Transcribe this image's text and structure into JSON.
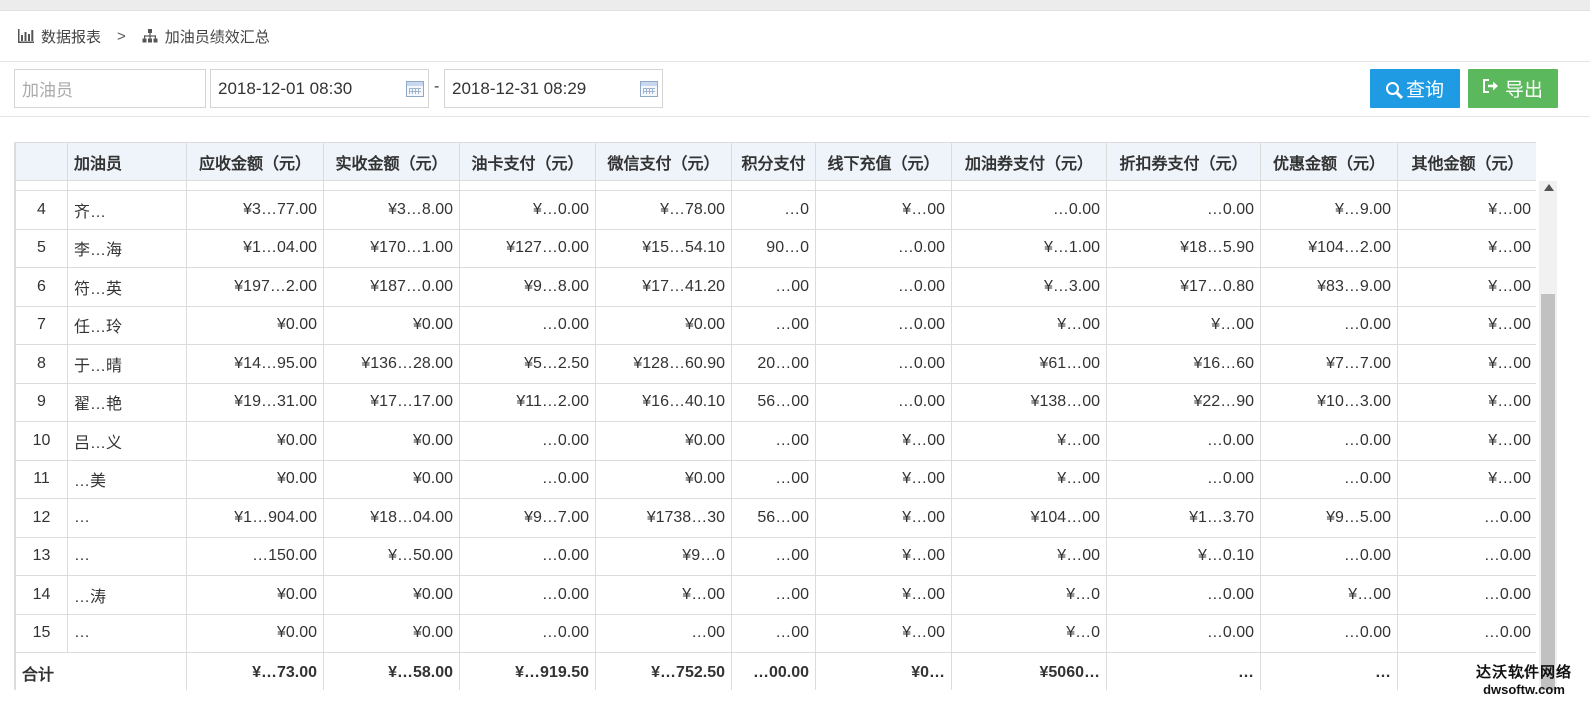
{
  "breadcrumb": {
    "parent": "数据报表",
    "separator": ">",
    "current": "加油员绩效汇总"
  },
  "filters": {
    "attendant_placeholder": "加油员",
    "start_time": "2018-12-01 08:30",
    "range_separator": "-",
    "end_time": "2018-12-31 08:29"
  },
  "buttons": {
    "query": "查询",
    "export": "导出"
  },
  "table": {
    "columns": [
      "",
      "加油员",
      "应收金额（元）",
      "实收金额（元）",
      "油卡支付（元）",
      "微信支付（元）",
      "积分支付",
      "线下充值（元）",
      "加油券支付（元）",
      "折扣券支付（元）",
      "优惠金额（元）",
      "其他金额（元）"
    ],
    "rows": [
      [
        "4",
        "齐…",
        "¥3…77.00",
        "¥3…8.00",
        "¥…0.00",
        "¥…78.00",
        "…0",
        "¥…00",
        "…0.00",
        "…0.00",
        "¥…9.00",
        "¥…00"
      ],
      [
        "5",
        "李…海",
        "¥1…04.00",
        "¥170…1.00",
        "¥127…0.00",
        "¥15…54.10",
        "90…0",
        "…0.00",
        "¥…1.00",
        "¥18…5.90",
        "¥104…2.00",
        "¥…00"
      ],
      [
        "6",
        "符…英",
        "¥197…2.00",
        "¥187…0.00",
        "¥9…8.00",
        "¥17…41.20",
        "…00",
        "…0.00",
        "¥…3.00",
        "¥17…0.80",
        "¥83…9.00",
        "¥…00"
      ],
      [
        "7",
        "任…玲",
        "¥0.00",
        "¥0.00",
        "…0.00",
        "¥0.00",
        "…00",
        "…0.00",
        "¥…00",
        "¥…00",
        "…0.00",
        "¥…00"
      ],
      [
        "8",
        "于…晴",
        "¥14…95.00",
        "¥136…28.00",
        "¥5…2.50",
        "¥128…60.90",
        "20…00",
        "…0.00",
        "¥61…00",
        "¥16…60",
        "¥7…7.00",
        "¥…00"
      ],
      [
        "9",
        "翟…艳",
        "¥19…31.00",
        "¥17…17.00",
        "¥11…2.00",
        "¥16…40.10",
        "56…00",
        "…0.00",
        "¥138…00",
        "¥22…90",
        "¥10…3.00",
        "¥…00"
      ],
      [
        "10",
        "吕…义",
        "¥0.00",
        "¥0.00",
        "…0.00",
        "¥0.00",
        "…00",
        "¥…00",
        "¥…00",
        "…0.00",
        "…0.00",
        "¥…00"
      ],
      [
        "11",
        "…美",
        "¥0.00",
        "¥0.00",
        "…0.00",
        "¥0.00",
        "…00",
        "¥…00",
        "¥…00",
        "…0.00",
        "…0.00",
        "¥…00"
      ],
      [
        "12",
        "…",
        "¥1…904.00",
        "¥18…04.00",
        "¥9…7.00",
        "¥1738…30",
        "56…00",
        "¥…00",
        "¥104…00",
        "¥1…3.70",
        "¥9…5.00",
        "…0.00"
      ],
      [
        "13",
        "…",
        "…150.00",
        "¥…50.00",
        "…0.00",
        "¥9…0",
        "…00",
        "¥…00",
        "¥…00",
        "¥…0.10",
        "…0.00",
        "…0.00"
      ],
      [
        "14",
        "…涛",
        "¥0.00",
        "¥0.00",
        "…0.00",
        "¥…00",
        "…00",
        "¥…00",
        "¥…0",
        "…0.00",
        "¥…00",
        "…0.00"
      ],
      [
        "15",
        "…",
        "¥0.00",
        "¥0.00",
        "…0.00",
        "…00",
        "…00",
        "¥…00",
        "¥…0",
        "…0.00",
        "…0.00",
        "…0.00"
      ]
    ],
    "total": [
      "合计",
      "",
      "¥…73.00",
      "¥…58.00",
      "¥…919.50",
      "¥…752.50",
      "…00.00",
      "¥0…",
      "¥5060…",
      "…",
      "…",
      "…"
    ]
  },
  "watermark": {
    "line1": "达沃软件网络",
    "line2": "dwsoftw.com"
  },
  "colors": {
    "query_button": "#1e9be2",
    "export_button": "#5cb85c",
    "header_bg": "#eef4fa"
  },
  "icons": {
    "breadcrumb_parent": "bar-chart-icon",
    "breadcrumb_current": "sitemap-icon",
    "query": "search-icon",
    "export": "sign-out-icon",
    "date": "calendar-icon"
  }
}
